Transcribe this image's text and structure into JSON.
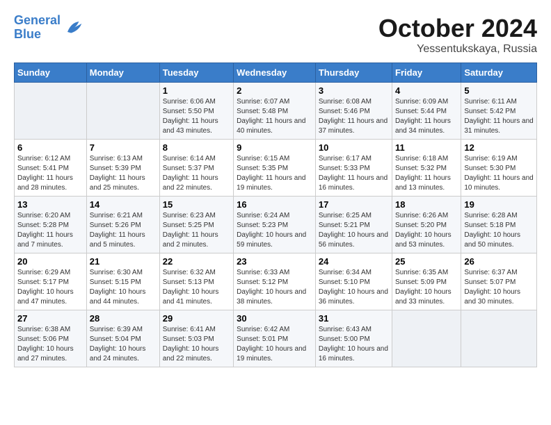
{
  "header": {
    "logo_line1": "General",
    "logo_line2": "Blue",
    "month_title": "October 2024",
    "location": "Yessentukskaya, Russia"
  },
  "weekdays": [
    "Sunday",
    "Monday",
    "Tuesday",
    "Wednesday",
    "Thursday",
    "Friday",
    "Saturday"
  ],
  "weeks": [
    [
      {
        "day": "",
        "info": ""
      },
      {
        "day": "",
        "info": ""
      },
      {
        "day": "1",
        "info": "Sunrise: 6:06 AM\nSunset: 5:50 PM\nDaylight: 11 hours and 43 minutes."
      },
      {
        "day": "2",
        "info": "Sunrise: 6:07 AM\nSunset: 5:48 PM\nDaylight: 11 hours and 40 minutes."
      },
      {
        "day": "3",
        "info": "Sunrise: 6:08 AM\nSunset: 5:46 PM\nDaylight: 11 hours and 37 minutes."
      },
      {
        "day": "4",
        "info": "Sunrise: 6:09 AM\nSunset: 5:44 PM\nDaylight: 11 hours and 34 minutes."
      },
      {
        "day": "5",
        "info": "Sunrise: 6:11 AM\nSunset: 5:42 PM\nDaylight: 11 hours and 31 minutes."
      }
    ],
    [
      {
        "day": "6",
        "info": "Sunrise: 6:12 AM\nSunset: 5:41 PM\nDaylight: 11 hours and 28 minutes."
      },
      {
        "day": "7",
        "info": "Sunrise: 6:13 AM\nSunset: 5:39 PM\nDaylight: 11 hours and 25 minutes."
      },
      {
        "day": "8",
        "info": "Sunrise: 6:14 AM\nSunset: 5:37 PM\nDaylight: 11 hours and 22 minutes."
      },
      {
        "day": "9",
        "info": "Sunrise: 6:15 AM\nSunset: 5:35 PM\nDaylight: 11 hours and 19 minutes."
      },
      {
        "day": "10",
        "info": "Sunrise: 6:17 AM\nSunset: 5:33 PM\nDaylight: 11 hours and 16 minutes."
      },
      {
        "day": "11",
        "info": "Sunrise: 6:18 AM\nSunset: 5:32 PM\nDaylight: 11 hours and 13 minutes."
      },
      {
        "day": "12",
        "info": "Sunrise: 6:19 AM\nSunset: 5:30 PM\nDaylight: 11 hours and 10 minutes."
      }
    ],
    [
      {
        "day": "13",
        "info": "Sunrise: 6:20 AM\nSunset: 5:28 PM\nDaylight: 11 hours and 7 minutes."
      },
      {
        "day": "14",
        "info": "Sunrise: 6:21 AM\nSunset: 5:26 PM\nDaylight: 11 hours and 5 minutes."
      },
      {
        "day": "15",
        "info": "Sunrise: 6:23 AM\nSunset: 5:25 PM\nDaylight: 11 hours and 2 minutes."
      },
      {
        "day": "16",
        "info": "Sunrise: 6:24 AM\nSunset: 5:23 PM\nDaylight: 10 hours and 59 minutes."
      },
      {
        "day": "17",
        "info": "Sunrise: 6:25 AM\nSunset: 5:21 PM\nDaylight: 10 hours and 56 minutes."
      },
      {
        "day": "18",
        "info": "Sunrise: 6:26 AM\nSunset: 5:20 PM\nDaylight: 10 hours and 53 minutes."
      },
      {
        "day": "19",
        "info": "Sunrise: 6:28 AM\nSunset: 5:18 PM\nDaylight: 10 hours and 50 minutes."
      }
    ],
    [
      {
        "day": "20",
        "info": "Sunrise: 6:29 AM\nSunset: 5:17 PM\nDaylight: 10 hours and 47 minutes."
      },
      {
        "day": "21",
        "info": "Sunrise: 6:30 AM\nSunset: 5:15 PM\nDaylight: 10 hours and 44 minutes."
      },
      {
        "day": "22",
        "info": "Sunrise: 6:32 AM\nSunset: 5:13 PM\nDaylight: 10 hours and 41 minutes."
      },
      {
        "day": "23",
        "info": "Sunrise: 6:33 AM\nSunset: 5:12 PM\nDaylight: 10 hours and 38 minutes."
      },
      {
        "day": "24",
        "info": "Sunrise: 6:34 AM\nSunset: 5:10 PM\nDaylight: 10 hours and 36 minutes."
      },
      {
        "day": "25",
        "info": "Sunrise: 6:35 AM\nSunset: 5:09 PM\nDaylight: 10 hours and 33 minutes."
      },
      {
        "day": "26",
        "info": "Sunrise: 6:37 AM\nSunset: 5:07 PM\nDaylight: 10 hours and 30 minutes."
      }
    ],
    [
      {
        "day": "27",
        "info": "Sunrise: 6:38 AM\nSunset: 5:06 PM\nDaylight: 10 hours and 27 minutes."
      },
      {
        "day": "28",
        "info": "Sunrise: 6:39 AM\nSunset: 5:04 PM\nDaylight: 10 hours and 24 minutes."
      },
      {
        "day": "29",
        "info": "Sunrise: 6:41 AM\nSunset: 5:03 PM\nDaylight: 10 hours and 22 minutes."
      },
      {
        "day": "30",
        "info": "Sunrise: 6:42 AM\nSunset: 5:01 PM\nDaylight: 10 hours and 19 minutes."
      },
      {
        "day": "31",
        "info": "Sunrise: 6:43 AM\nSunset: 5:00 PM\nDaylight: 10 hours and 16 minutes."
      },
      {
        "day": "",
        "info": ""
      },
      {
        "day": "",
        "info": ""
      }
    ]
  ]
}
